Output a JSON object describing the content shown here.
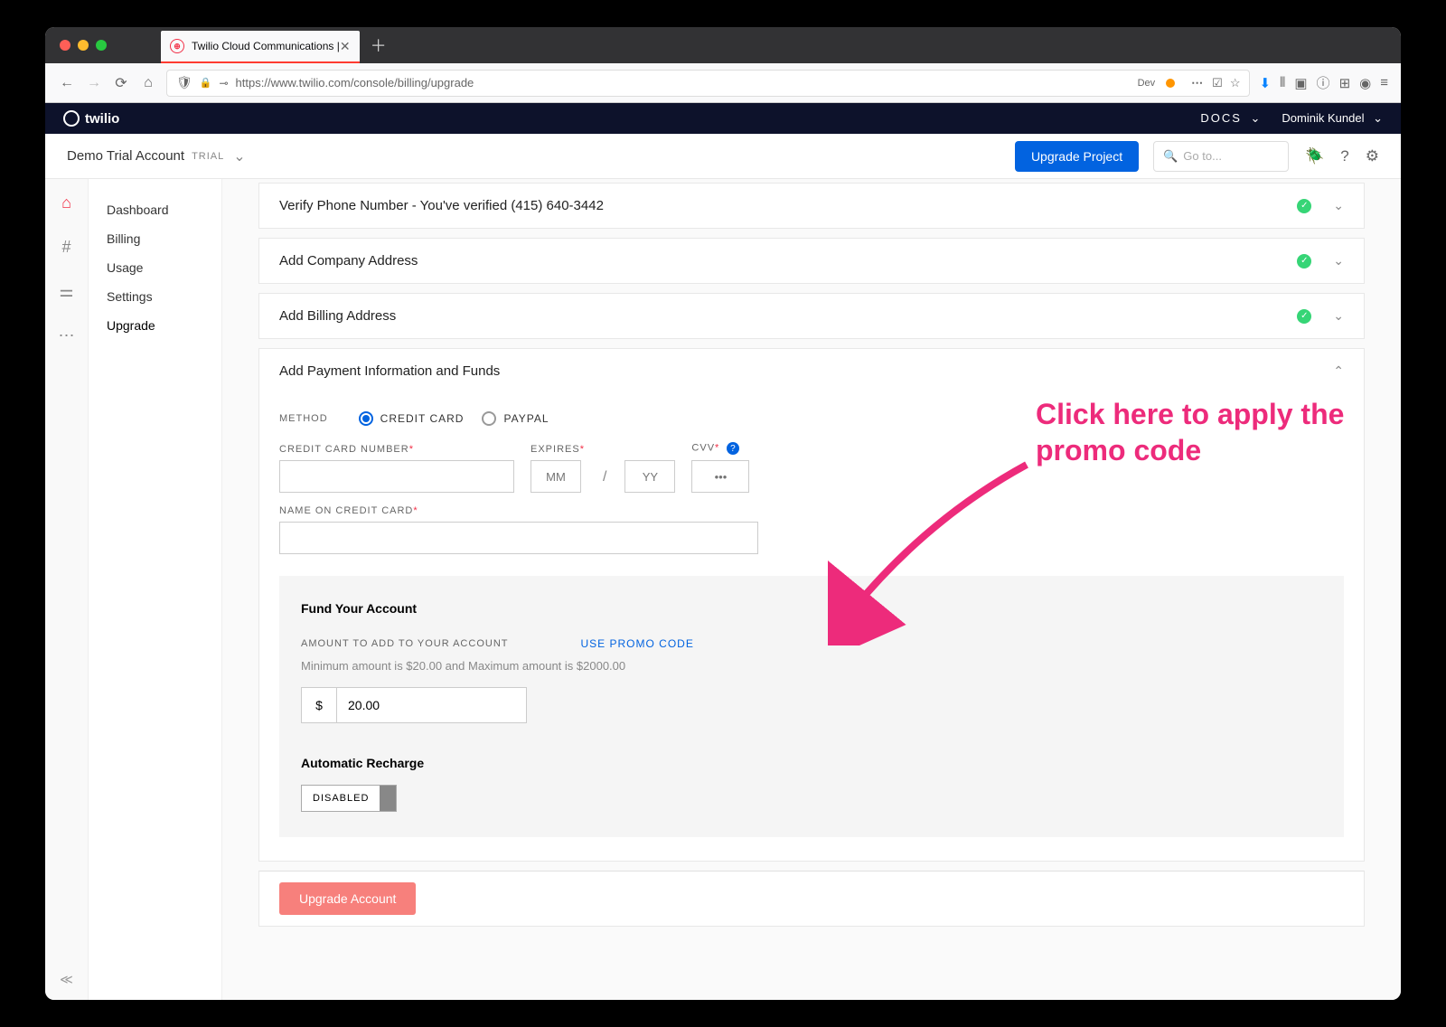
{
  "browser": {
    "tab_title": "Twilio Cloud Communications |",
    "url": "https://www.twilio.com/console/billing/upgrade",
    "dev_label": "Dev"
  },
  "header": {
    "brand": "twilio",
    "docs": "DOCS",
    "user": "Dominik Kundel"
  },
  "subheader": {
    "project": "Demo Trial Account",
    "trial": "TRIAL",
    "upgrade_btn": "Upgrade Project",
    "search_placeholder": "Go to..."
  },
  "sidenav": {
    "items": [
      "Dashboard",
      "Billing",
      "Usage",
      "Settings",
      "Upgrade"
    ]
  },
  "panels": {
    "verify": "Verify Phone Number - You've verified (415) 640-3442",
    "company": "Add Company Address",
    "billing": "Add Billing Address",
    "payment": "Add Payment Information and Funds"
  },
  "payment": {
    "method_label": "METHOD",
    "credit_card": "CREDIT CARD",
    "paypal": "PAYPAL",
    "cc_label": "CREDIT CARD NUMBER",
    "expires_label": "EXPIRES",
    "cvv_label": "CVV",
    "mm_ph": "MM",
    "yy_ph": "YY",
    "cvv_ph": "•••",
    "name_label": "NAME ON CREDIT CARD"
  },
  "fund": {
    "title": "Fund Your Account",
    "amount_label": "AMOUNT TO ADD TO YOUR ACCOUNT",
    "promo": "USE PROMO CODE",
    "minmax": "Minimum amount is $20.00 and Maximum amount is $2000.00",
    "currency": "$",
    "amount_value": "20.00",
    "auto_title": "Automatic Recharge",
    "disabled": "DISABLED"
  },
  "footer": {
    "upgrade_account": "Upgrade Account"
  },
  "annotation": {
    "text": "Click here to apply the promo code"
  }
}
